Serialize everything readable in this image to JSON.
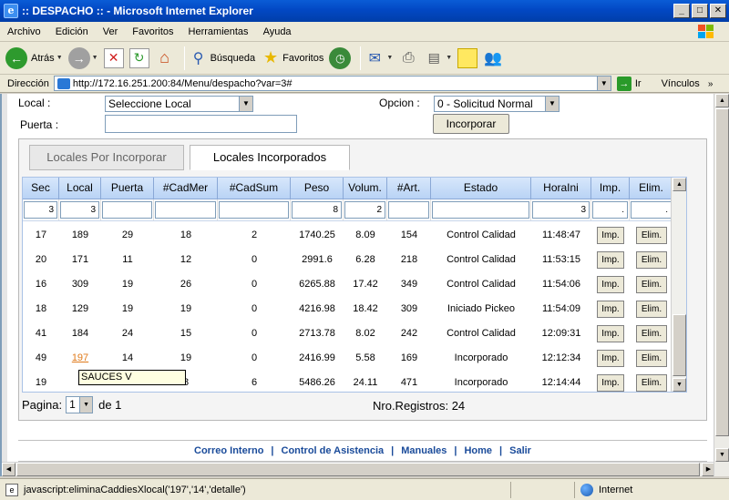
{
  "window": {
    "title": ":: DESPACHO :: - Microsoft Internet Explorer"
  },
  "menu": [
    "Archivo",
    "Edición",
    "Ver",
    "Favoritos",
    "Herramientas",
    "Ayuda"
  ],
  "toolbar": {
    "back": "Atrás",
    "search": "Búsqueda",
    "favorites": "Favoritos"
  },
  "address": {
    "label": "Dirección",
    "url": "http://172.16.251.200:84/Menu/despacho?var=3#",
    "go": "Ir",
    "links": "Vínculos"
  },
  "form": {
    "local_label": "Local :",
    "local_select": "Seleccione Local",
    "opcion_label": "Opcion :",
    "opcion_select": "0 - Solicitud Normal",
    "puerta_label": "Puerta :",
    "incorporar_button": "Incorporar"
  },
  "tabs": [
    "Locales Por Incorporar",
    "Locales Incorporados"
  ],
  "grid": {
    "columns": [
      "Sec",
      "Local",
      "Puerta",
      "#CadMer",
      "#CadSum",
      "Peso",
      "Volum.",
      "#Art.",
      "Estado",
      "HoraIni",
      "Imp.",
      "Elim."
    ],
    "filters": [
      "3",
      "3",
      "",
      "",
      "",
      "8",
      "2",
      "",
      "",
      "3",
      ".",
      "."
    ],
    "rows": [
      [
        "17",
        "189",
        "29",
        "18",
        "2",
        "1740.25",
        "8.09",
        "154",
        "Control Calidad",
        "11:48:47"
      ],
      [
        "20",
        "171",
        "11",
        "12",
        "0",
        "2991.6",
        "6.28",
        "218",
        "Control Calidad",
        "11:53:15"
      ],
      [
        "16",
        "309",
        "19",
        "26",
        "0",
        "6265.88",
        "17.42",
        "349",
        "Control Calidad",
        "11:54:06"
      ],
      [
        "18",
        "129",
        "19",
        "19",
        "0",
        "4216.98",
        "18.42",
        "309",
        "Iniciado Pickeo",
        "11:54:09"
      ],
      [
        "41",
        "184",
        "24",
        "15",
        "0",
        "2713.78",
        "8.02",
        "242",
        "Control Calidad",
        "12:09:31"
      ],
      [
        "49",
        "197",
        "14",
        "19",
        "0",
        "2416.99",
        "5.58",
        "169",
        "Incorporado",
        "12:12:34"
      ],
      [
        "19",
        "1",
        "",
        "8",
        "6",
        "5486.26",
        "24.11",
        "471",
        "Incorporado",
        "12:14:44"
      ]
    ],
    "imp_label": "Imp.",
    "elim_label": "Elim.",
    "tooltip": "SAUCES V"
  },
  "pager": {
    "label": "Pagina:",
    "page": "1",
    "of": "de 1",
    "records": "Nro.Registros: 24"
  },
  "footer": [
    "Correo Interno",
    "Control de Asistencia",
    "Manuales",
    "Home",
    "Salir"
  ],
  "status": {
    "text": "javascript:eliminaCaddiesXlocal('197','14','detalle')",
    "zone": "Internet"
  }
}
